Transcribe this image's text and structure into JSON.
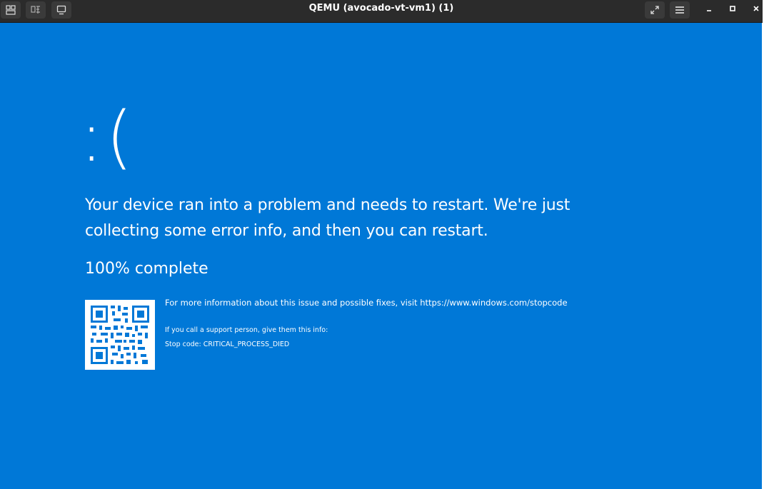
{
  "window": {
    "title": "QEMU (avocado-vt-vm1) (1)"
  },
  "toolbar": {
    "buttons": [
      {
        "icon": "tabs-icon"
      },
      {
        "icon": "ctrl-alt-del-icon"
      },
      {
        "icon": "display-icon"
      }
    ],
    "right_buttons": [
      {
        "icon": "fullscreen-icon"
      },
      {
        "icon": "hamburger-menu-icon"
      }
    ],
    "window_controls": [
      {
        "icon": "minimize-icon"
      },
      {
        "icon": "maximize-icon"
      },
      {
        "icon": "close-icon"
      }
    ]
  },
  "bsod": {
    "frown": ":(",
    "message": "Your device ran into a problem and needs to restart. We're just collecting some error info, and then you can restart.",
    "progress": "100% complete",
    "info": "For more information about this issue and possible fixes, visit https://www.windows.com/stopcode",
    "support": "If you call a support person, give them this info:",
    "stop_code": "Stop code: CRITICAL_PROCESS_DIED"
  },
  "colors": {
    "bsod_background": "#0078d7",
    "titlebar": "#2b2b2b",
    "text": "#ffffff"
  }
}
